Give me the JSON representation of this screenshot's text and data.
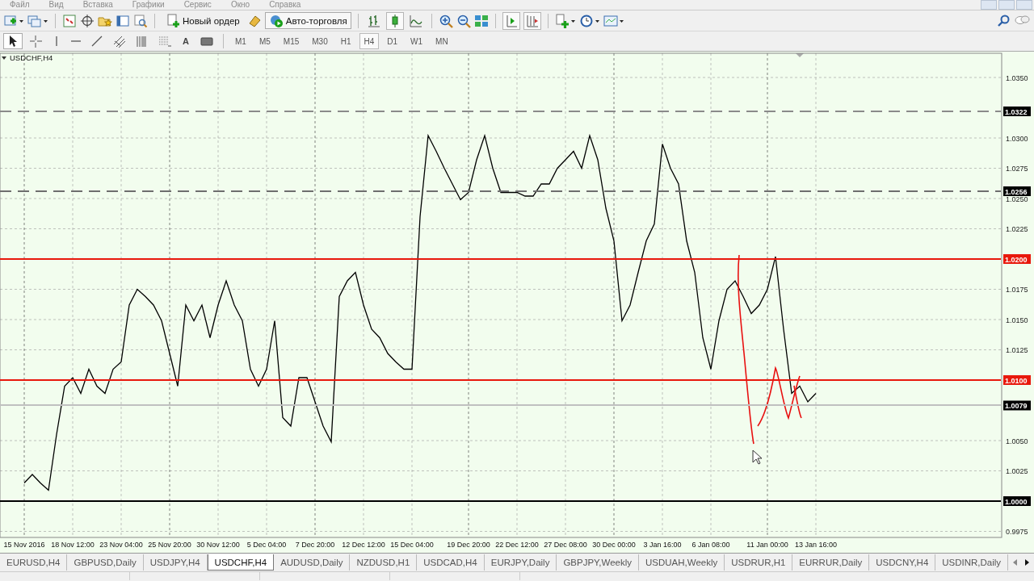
{
  "menu": [
    "Файл",
    "Вид",
    "Вставка",
    "Графики",
    "Сервис",
    "Окно",
    "Справка"
  ],
  "toolbar": {
    "new_order": {
      "label": "Новый ордер"
    },
    "auto_trading": {
      "label": "Авто-торговля",
      "on": true
    },
    "chart_types": [
      {
        "kind": "bars",
        "selected": false
      },
      {
        "kind": "candles",
        "selected": true
      },
      {
        "kind": "line",
        "selected": false
      }
    ],
    "auto_scroll": {
      "on": true
    },
    "chart_shift": {
      "on": true
    }
  },
  "drawing_tools": [
    {
      "kind": "cursor",
      "selected": true
    },
    {
      "kind": "crosshair",
      "selected": false
    },
    {
      "kind": "vertical-line",
      "selected": false
    },
    {
      "kind": "horizontal-line",
      "selected": false
    },
    {
      "kind": "trendline",
      "selected": false
    },
    {
      "kind": "channel",
      "selected": false
    },
    {
      "kind": "fibo",
      "selected": false
    },
    {
      "kind": "fibo-grid",
      "selected": false
    },
    {
      "kind": "text",
      "label": "A",
      "selected": false
    },
    {
      "kind": "text-label",
      "selected": false
    }
  ],
  "timeframes": [
    {
      "label": "M1",
      "selected": false
    },
    {
      "label": "M5",
      "selected": false
    },
    {
      "label": "M15",
      "selected": false
    },
    {
      "label": "M30",
      "selected": false
    },
    {
      "label": "H1",
      "selected": false
    },
    {
      "label": "H4",
      "selected": true
    },
    {
      "label": "D1",
      "selected": false
    },
    {
      "label": "W1",
      "selected": false
    },
    {
      "label": "MN",
      "selected": false
    }
  ],
  "chart": {
    "title": "USDCHF,H4",
    "price_levels": [
      {
        "label": "1.0322",
        "color": "#8a8a8a"
      },
      {
        "label": "1.0256",
        "color": "#6e6e6e"
      },
      {
        "label": "1.0200",
        "color": "#e8180c"
      },
      {
        "label": "1.0100",
        "color": "#e8180c"
      },
      {
        "label": "1.0079",
        "color": "#c0c0c0"
      },
      {
        "label": "1.0000",
        "color": "#000000"
      }
    ],
    "chart_data": {
      "type": "line",
      "grid": true,
      "categories": [
        "15 Nov 2016",
        null,
        null,
        null,
        null,
        null,
        "18 Nov 12:00",
        null,
        null,
        null,
        null,
        null,
        "23 Nov 04:00",
        null,
        null,
        null,
        null,
        null,
        "25 Nov 20:00",
        null,
        null,
        null,
        null,
        null,
        "30 Nov 12:00",
        null,
        null,
        null,
        null,
        null,
        "5 Dec 04:00",
        null,
        null,
        null,
        null,
        null,
        "7 Dec 20:00",
        null,
        null,
        null,
        null,
        null,
        "12 Dec 12:00",
        null,
        null,
        null,
        null,
        null,
        "15 Dec 04:00",
        null,
        null,
        null,
        null,
        null,
        null,
        "19 Dec 20:00",
        null,
        null,
        null,
        null,
        null,
        "22 Dec 12:00",
        null,
        null,
        null,
        null,
        null,
        "27 Dec 08:00",
        null,
        null,
        null,
        null,
        null,
        "30 Dec 00:00",
        null,
        null,
        null,
        null,
        null,
        "3 Jan 16:00",
        null,
        null,
        null,
        null,
        null,
        "6 Jan 08:00",
        null,
        null,
        null,
        null,
        null,
        null,
        "11 Jan 00:00",
        null,
        null,
        null,
        null,
        null,
        "13 Jan 16:00"
      ],
      "series": [
        {
          "color": "#000000",
          "values": [
            1.0015,
            1.0022,
            1.0015,
            1.0009,
            1.0055,
            1.0095,
            1.0102,
            1.0089,
            1.0109,
            1.0095,
            1.0089,
            1.0109,
            1.0115,
            1.0162,
            1.0175,
            1.0169,
            1.0162,
            1.0149,
            1.0122,
            1.0095,
            1.0162,
            1.0149,
            1.0162,
            1.0135,
            1.0162,
            1.0182,
            1.0162,
            1.0149,
            1.0109,
            1.0095,
            1.0109,
            1.0149,
            1.0069,
            1.0062,
            1.0102,
            1.0102,
            1.0082,
            1.0062,
            1.0049,
            1.0169,
            1.0182,
            1.0189,
            1.0162,
            1.0142,
            1.0135,
            1.0122,
            1.0115,
            1.0109,
            1.0109,
            1.0235,
            1.0302,
            1.0289,
            1.0275,
            1.0262,
            1.0249,
            1.0255,
            1.0282,
            1.0302,
            1.0275,
            1.0255,
            1.0255,
            1.0255,
            1.0252,
            1.0252,
            1.0262,
            1.0262,
            1.0275,
            1.0282,
            1.0289,
            1.0275,
            1.0302,
            1.0282,
            1.0242,
            1.0215,
            1.0149,
            1.0162,
            1.0189,
            1.0215,
            1.0229,
            1.0295,
            1.0275,
            1.0262,
            1.0215,
            1.0189,
            1.0135,
            1.0109,
            1.0149,
            1.0175,
            1.0182,
            1.0169,
            1.0155,
            1.0162,
            1.0175,
            1.0202,
            1.0142,
            1.0089,
            1.0095,
            1.0082,
            1.0089
          ]
        }
      ],
      "ylim": [
        0.997,
        1.037
      ],
      "yticks": [
        {
          "value": 1.035,
          "label": "1.0350"
        },
        {
          "value": 1.03,
          "label": "1.0300"
        },
        {
          "value": 1.0275,
          "label": "1.0275"
        },
        {
          "value": 1.025,
          "label": "1.0250"
        },
        {
          "value": 1.0225,
          "label": "1.0225"
        },
        {
          "value": 1.0175,
          "label": "1.0175"
        },
        {
          "value": 1.015,
          "label": "1.0150"
        },
        {
          "value": 1.0125,
          "label": "1.0125"
        },
        {
          "value": 1.005,
          "label": "1.0050"
        },
        {
          "value": 1.0025,
          "label": "1.0025"
        },
        {
          "value": 0.9975,
          "label": "0.9975"
        }
      ]
    }
  },
  "tabs": [
    {
      "label": "EURUSD,H4",
      "selected": false
    },
    {
      "label": "GBPUSD,Daily",
      "selected": false
    },
    {
      "label": "USDJPY,H4",
      "selected": false
    },
    {
      "label": "USDCHF,H4",
      "selected": true
    },
    {
      "label": "AUDUSD,Daily",
      "selected": false
    },
    {
      "label": "NZDUSD,H1",
      "selected": false
    },
    {
      "label": "USDCAD,H4",
      "selected": false
    },
    {
      "label": "EURJPY,Daily",
      "selected": false
    },
    {
      "label": "GBPJPY,Weekly",
      "selected": false
    },
    {
      "label": "USDUAH,Weekly",
      "selected": false
    },
    {
      "label": "USDRUR,H1",
      "selected": false
    },
    {
      "label": "EURRUR,Daily",
      "selected": false
    },
    {
      "label": "USDCNY,H4",
      "selected": false
    },
    {
      "label": "USDINR,Daily",
      "selected": false
    }
  ]
}
